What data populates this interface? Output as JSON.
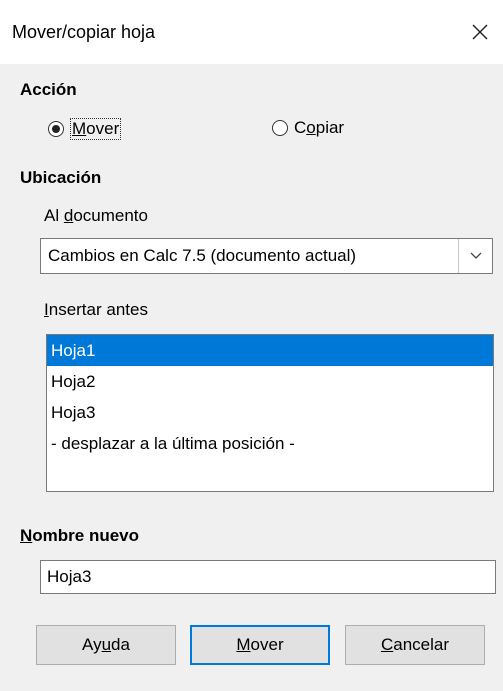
{
  "window": {
    "title": "Mover/copiar hoja"
  },
  "action": {
    "heading": "Acción",
    "move_pre": "",
    "move_key": "M",
    "move_post": "over",
    "copy_pre": "C",
    "copy_key": "o",
    "copy_post": "piar",
    "selected": "move"
  },
  "location": {
    "heading": "Ubicación",
    "doc_label_pre": "Al ",
    "doc_label_key": "d",
    "doc_label_post": "ocumento",
    "doc_value": "Cambios en Calc 7.5 (documento actual)",
    "insert_label_key": "I",
    "insert_label_post": "nsertar antes",
    "sheets": [
      "Hoja1",
      "Hoja2",
      "Hoja3",
      "- desplazar a la última posición -"
    ],
    "selected_index": 0
  },
  "new_name": {
    "label_key": "N",
    "label_post": "ombre nuevo",
    "value": "Hoja3"
  },
  "buttons": {
    "help_pre": "Ay",
    "help_key": "u",
    "help_post": "da",
    "move_key": "M",
    "move_post": "over",
    "cancel_key": "C",
    "cancel_post": "ancelar"
  }
}
